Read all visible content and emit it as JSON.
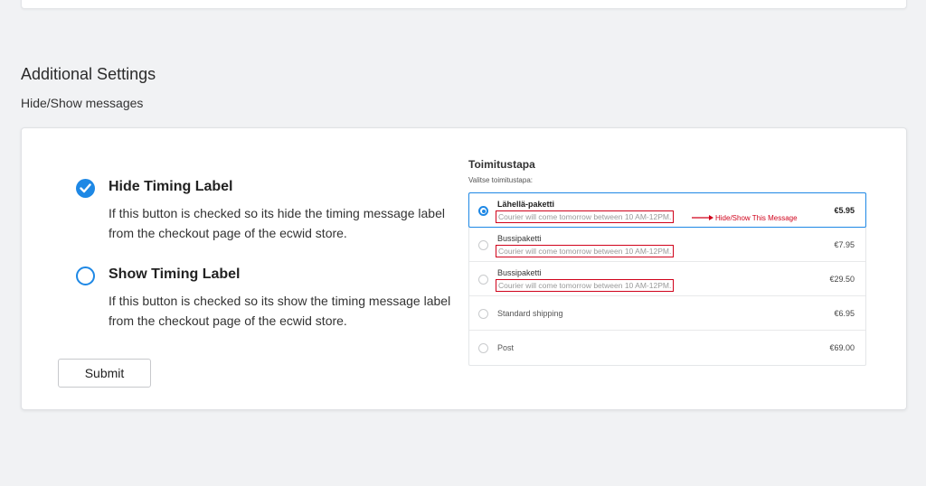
{
  "section": {
    "title": "Additional Settings",
    "subtitle": "Hide/Show messages"
  },
  "options": [
    {
      "title": "Hide Timing Label",
      "description": "If this button is checked so its hide the timing message label from the checkout page of the ecwid store.",
      "checked": true
    },
    {
      "title": "Show Timing Label",
      "description": "If this button is checked so its show the timing message label from the checkout page of the ecwid store.",
      "checked": false
    }
  ],
  "submit_label": "Submit",
  "preview": {
    "title": "Toimitustapa",
    "subtitle": "Valitse toimitustapa:",
    "annotation": "Hide/Show This Message",
    "rows": [
      {
        "name": "Lähellä-paketti",
        "message": "Courier will come tomorrow between 10 AM-12PM.",
        "price": "€5.95",
        "selected": true
      },
      {
        "name": "Bussipaketti",
        "message": "Courier will come tomorrow between 10 AM-12PM.",
        "price": "€7.95",
        "selected": false
      },
      {
        "name": "Bussipaketti",
        "message": "Courier will come tomorrow between 10 AM-12PM.",
        "price": "€29.50",
        "selected": false
      },
      {
        "name": "Standard shipping",
        "message": "",
        "price": "€6.95",
        "selected": false
      },
      {
        "name": "Post",
        "message": "",
        "price": "€69.00",
        "selected": false
      }
    ]
  },
  "colors": {
    "accent": "#1e88e5",
    "highlight": "#d0021b"
  },
  "icons": {
    "checked": "check-icon",
    "annotation": "arrow-right-icon"
  }
}
